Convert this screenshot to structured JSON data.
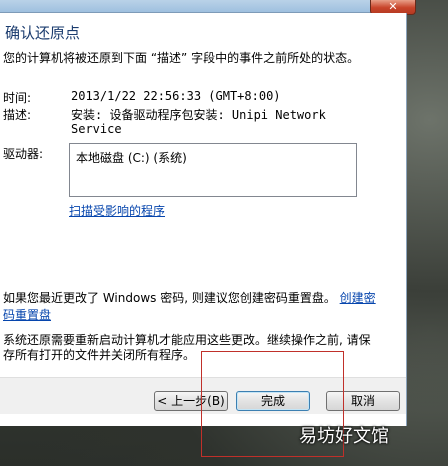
{
  "window": {
    "close_label": "✕"
  },
  "dialog": {
    "heading": "确认还原点",
    "subtitle": "您的计算机将被还原到下面 “描述” 字段中的事件之前所处的状态。",
    "time_label": "时间:",
    "time_value": "2013/1/22 22:56:33 (GMT+8:00)",
    "desc_label": "描述:",
    "desc_value_line1": "安装: 设备驱动程序包安装: Unipi Network",
    "desc_value_line2": "Service",
    "drives_label": "驱动器:",
    "drives": [
      "本地磁盘 (C:) (系统)"
    ],
    "scan_link": "扫描受影响的程序",
    "password_text": "如果您最近更改了 Windows 密码, 则建议您创建密码重置盘。",
    "password_link_part1": "创建密",
    "password_link_part2": "码重置盘",
    "restart_note_line1": "系统还原需要重新启动计算机才能应用这些更改。继续操作之前, 请保",
    "restart_note_line2": "存所有打开的文件并关闭所有程序。"
  },
  "buttons": {
    "back": "< 上一步(B)",
    "finish": "完成",
    "cancel": "取消"
  },
  "watermark": "易坊好文馆",
  "colors": {
    "link": "#0645ad",
    "heading": "#1a3b6e",
    "highlight_box": "#c0302a"
  }
}
